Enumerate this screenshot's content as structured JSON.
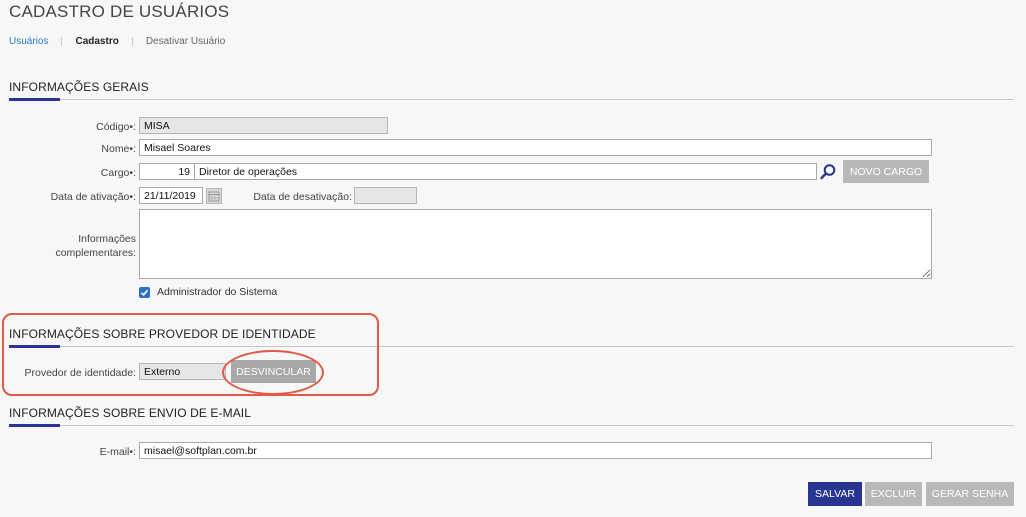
{
  "page": {
    "title": "CADASTRO DE USUÁRIOS"
  },
  "breadcrumb": {
    "items": [
      "Usuários",
      "Cadastro",
      "Desativar Usuário"
    ]
  },
  "sections": {
    "general": "INFORMAÇÕES GERAIS",
    "identity": "INFORMAÇÕES SOBRE PROVEDOR DE IDENTIDADE",
    "email": "INFORMAÇÕES SOBRE ENVIO DE E-MAIL"
  },
  "form": {
    "codigo": {
      "label": "Código•:",
      "value": "MISA"
    },
    "nome": {
      "label": "Nome•:",
      "value": "Misael Soares"
    },
    "cargo": {
      "label": "Cargo•:",
      "code": "19",
      "value": "Diretor de operações",
      "new_button": "NOVO CARGO"
    },
    "data_ativacao": {
      "label": "Data de ativação•:",
      "value": "21/11/2019"
    },
    "data_desativacao": {
      "label": "Data de desativação:",
      "value": ""
    },
    "info_compl": {
      "label_line1": "Informações",
      "label_line2": "complementares:",
      "value": ""
    },
    "admin": {
      "label": "Administrador do Sistema",
      "checked": true
    },
    "provedor": {
      "label": "Provedor de identidade:",
      "value": "Externo",
      "button": "DESVINCULAR"
    },
    "email": {
      "label": "E-mail•:",
      "value": "misael@softplan.com.br"
    }
  },
  "actions": {
    "save": "SALVAR",
    "delete": "EXCLUIR",
    "generate_password": "GERAR SENHA"
  },
  "colors": {
    "accent": "#283593",
    "link": "#2a78c2",
    "highlight": "#e05a47",
    "checkbox": "#2a6fc9"
  }
}
